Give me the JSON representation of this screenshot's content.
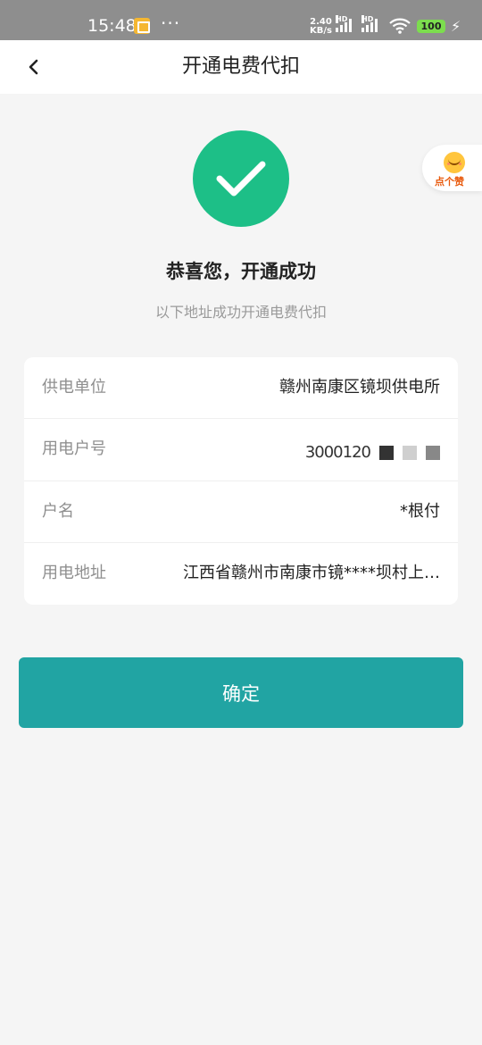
{
  "status_bar": {
    "time": "15:48",
    "dots": "···",
    "speed_value": "2.40",
    "speed_unit": "KB/s",
    "hd_label": "HD",
    "battery": "100",
    "colors": {
      "bar": "#8e8e8e",
      "battery": "#7cdd4e",
      "notif": "#f5b731"
    }
  },
  "nav": {
    "title": "开通电费代扣",
    "back_icon": "chevron-left-icon"
  },
  "success": {
    "icon": "check-circle-icon",
    "title": "恭喜您，开通成功",
    "subtitle": "以下地址成功开通电费代扣",
    "color": "#1dbf87"
  },
  "like_badge": {
    "text": "点个赞",
    "icon": "smile-face-icon"
  },
  "info": {
    "rows": [
      {
        "label": "供电单位",
        "value": "赣州南康区镜坝供电所"
      },
      {
        "label": "用电户号",
        "value": "3000120"
      },
      {
        "label": "户名",
        "value": "*根付"
      },
      {
        "label": "用电地址",
        "value": "江西省赣州市南康市镜****坝村上…"
      }
    ]
  },
  "confirm": {
    "label": "确定",
    "color": "#21a4a3"
  }
}
